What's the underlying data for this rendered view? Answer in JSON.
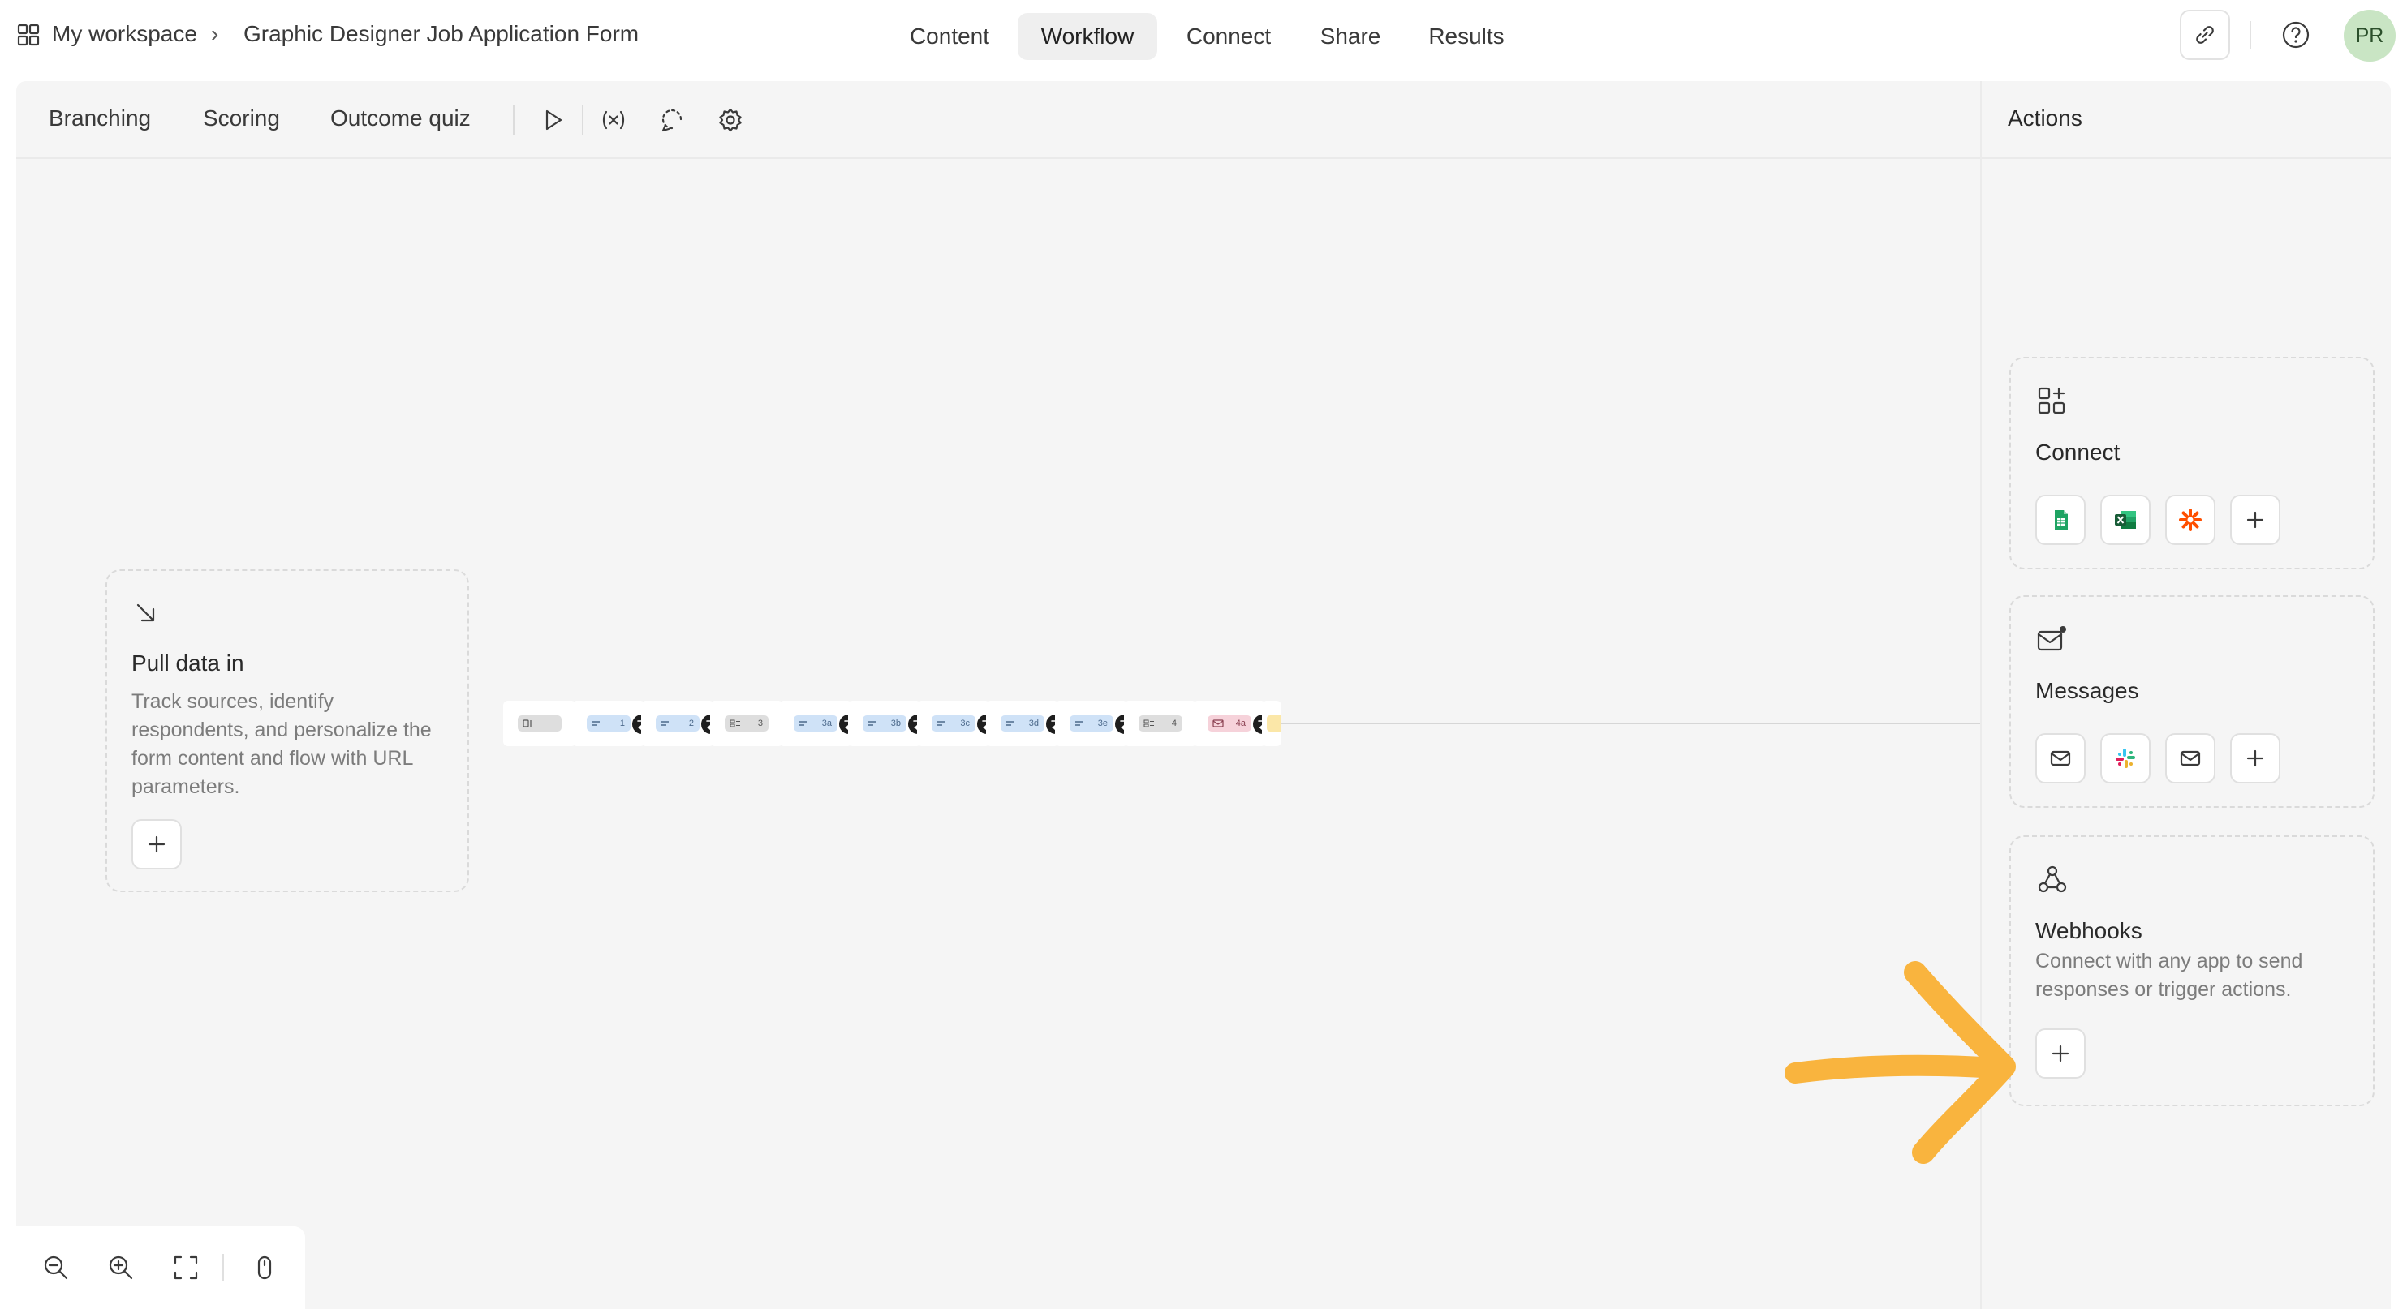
{
  "header": {
    "workspace": "My workspace",
    "separator": "›",
    "form_title": "Graphic Designer Job Application Form",
    "nav_tabs": [
      {
        "label": "Content",
        "active": false
      },
      {
        "label": "Workflow",
        "active": true
      },
      {
        "label": "Connect",
        "active": false
      },
      {
        "label": "Share",
        "active": false
      },
      {
        "label": "Results",
        "active": false
      }
    ],
    "avatar_initials": "PR",
    "avatar_color": "#c9e5c4"
  },
  "workflow_toolbar": {
    "tabs": [
      "Branching",
      "Scoring",
      "Outcome quiz"
    ],
    "icons": [
      "play-icon",
      "variables-icon",
      "loop-icon",
      "settings-icon"
    ]
  },
  "pull_data": {
    "title": "Pull data in",
    "description": "Track sources, identify respondents, and personalize the form content and flow with URL parameters."
  },
  "flow_nodes": [
    {
      "label": "",
      "kind": "welcome",
      "color": "gray",
      "has_logic": false
    },
    {
      "label": "1",
      "kind": "short-text",
      "color": "blue",
      "has_logic": true
    },
    {
      "label": "2",
      "kind": "short-text",
      "color": "blue",
      "has_logic": true
    },
    {
      "label": "3",
      "kind": "question-group",
      "color": "gray",
      "has_logic": false
    },
    {
      "label": "3a",
      "kind": "short-text",
      "color": "blue",
      "has_logic": true
    },
    {
      "label": "3b",
      "kind": "short-text",
      "color": "blue",
      "has_logic": true
    },
    {
      "label": "3c",
      "kind": "short-text",
      "color": "blue",
      "has_logic": true
    },
    {
      "label": "3d",
      "kind": "short-text",
      "color": "blue",
      "has_logic": true
    },
    {
      "label": "3e",
      "kind": "short-text",
      "color": "blue",
      "has_logic": true
    },
    {
      "label": "4",
      "kind": "question-group",
      "color": "gray",
      "has_logic": false
    },
    {
      "label": "4a",
      "kind": "email",
      "color": "pink",
      "has_logic": true
    },
    {
      "label": "",
      "kind": "partial",
      "color": "yellow",
      "has_logic": false
    }
  ],
  "actions": {
    "title": "Actions",
    "connect": {
      "title": "Connect",
      "apps": [
        "google-sheets-icon",
        "excel-icon",
        "zapier-icon",
        "plus-icon"
      ]
    },
    "messages": {
      "title": "Messages",
      "apps": [
        "email-icon",
        "slack-icon",
        "email-icon",
        "plus-icon"
      ]
    },
    "webhooks": {
      "title": "Webhooks",
      "description": "Connect with any app to send responses or trigger actions."
    }
  },
  "colors": {
    "accent_arrow": "#f9b43e",
    "canvas_bg": "#f5f5f5",
    "blue_pill": "#cfe2f7",
    "pink_pill": "#f6d2da"
  }
}
